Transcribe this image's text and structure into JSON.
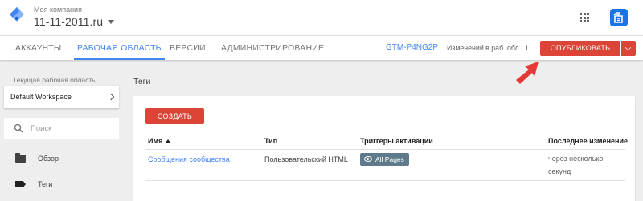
{
  "header": {
    "account_label": "Моя компания",
    "container_name": "11-11-2011.ru"
  },
  "nav": {
    "tabs": [
      "АККАУНТЫ",
      "РАБОЧАЯ ОБЛАСТЬ",
      "ВЕРСИИ",
      "АДМИНИСТРИРОВАНИЕ"
    ],
    "active_tab": "РАБОЧАЯ ОБЛАСТЬ",
    "container_id": "GTM-P4NG2P",
    "changes_text": "Изменений в раб. обл.: 1",
    "publish_label": "ОПУБЛИКОВАТЬ"
  },
  "sidebar": {
    "workspace_label": "Текущая рабочая область",
    "workspace_name": "Default Workspace",
    "search_placeholder": "Поиск",
    "items": [
      {
        "label": "Обзор",
        "icon": "folder-icon"
      },
      {
        "label": "Теги",
        "icon": "tag-icon",
        "active": true
      }
    ]
  },
  "main": {
    "title": "Теги",
    "create_label": "СОЗДАТЬ",
    "columns": [
      "Имя",
      "Тип",
      "Триггеры активации",
      "Последнее изменение"
    ],
    "sort_column": "Имя",
    "rows": [
      {
        "name": "Сообщения сообщества",
        "type": "Пользовательский HTML",
        "trigger": "All Pages",
        "modified": "через несколько секунд"
      }
    ]
  },
  "colors": {
    "accent_blue": "#4285f4",
    "publish_red": "#db4437",
    "trigger_chip": "#5f7a8a",
    "annotation_arrow": "#e53935"
  }
}
